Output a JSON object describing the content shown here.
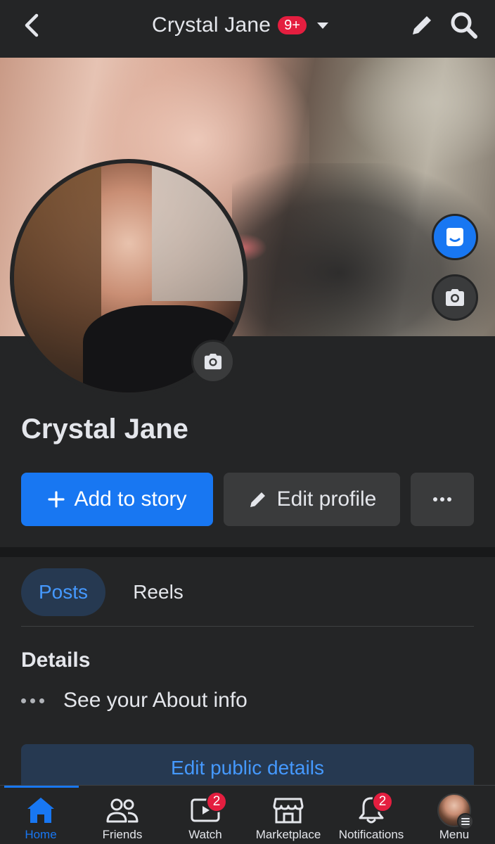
{
  "header": {
    "title": "Crystal Jane",
    "notification_badge": "9+"
  },
  "profile": {
    "name": "Crystal Jane"
  },
  "actions": {
    "add_to_story": "Add to story",
    "edit_profile": "Edit profile",
    "more": "···"
  },
  "tabs": [
    {
      "label": "Posts",
      "active": true
    },
    {
      "label": "Reels",
      "active": false
    }
  ],
  "details": {
    "title": "Details",
    "about_link": "See your About info",
    "edit_public_details": "Edit public details"
  },
  "bottom_nav": {
    "items": [
      {
        "label": "Home",
        "icon": "home-icon",
        "active": true
      },
      {
        "label": "Friends",
        "icon": "friends-icon"
      },
      {
        "label": "Watch",
        "icon": "watch-icon",
        "badge": "2"
      },
      {
        "label": "Marketplace",
        "icon": "marketplace-icon"
      },
      {
        "label": "Notifications",
        "icon": "bell-icon",
        "badge": "2"
      },
      {
        "label": "Menu",
        "icon": "menu-avatar"
      }
    ]
  },
  "colors": {
    "background": "#242526",
    "accent": "#1877f2",
    "badge": "#e41e3f",
    "secondary_button": "#3a3b3c",
    "active_tab_bg": "#263951",
    "active_tab_text": "#4599ff"
  }
}
